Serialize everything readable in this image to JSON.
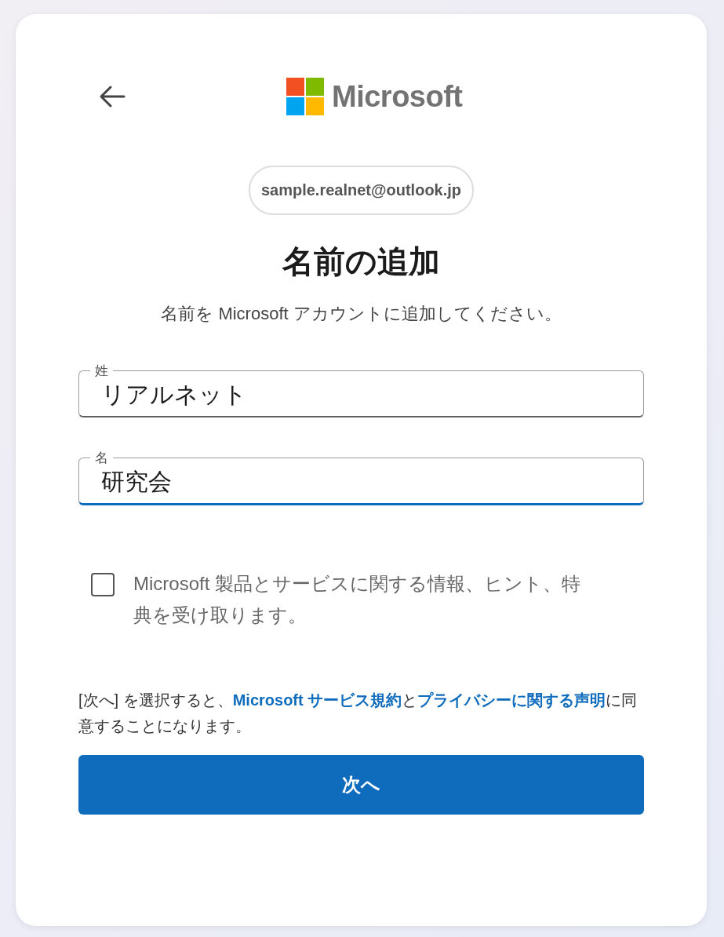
{
  "logo": {
    "text": "Microsoft"
  },
  "account_email": "sample.realnet@outlook.jp",
  "title": "名前の追加",
  "subtitle": "名前を Microsoft アカウントに追加してください。",
  "fields": [
    {
      "label": "姓",
      "value": "リアルネット",
      "focused": false
    },
    {
      "label": "名",
      "value": "研究会",
      "focused": true
    }
  ],
  "checkbox": {
    "label": "Microsoft 製品とサービスに関する情報、ヒント、特典を受け取ります。",
    "checked": false
  },
  "terms": [
    {
      "kind": "text",
      "text": "[次へ] を選択すると、"
    },
    {
      "kind": "link",
      "text": "Microsoft サービス規約"
    },
    {
      "kind": "text",
      "text": "と"
    },
    {
      "kind": "link",
      "text": "プライバシーに関する声明"
    },
    {
      "kind": "text",
      "text": "に同意することになります。"
    }
  ],
  "next_button": "次へ"
}
